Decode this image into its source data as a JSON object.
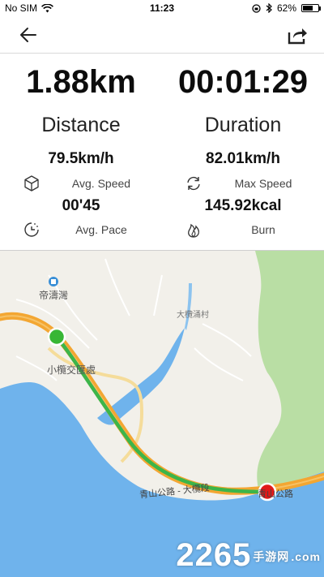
{
  "status_bar": {
    "carrier": "No SIM",
    "time": "11:23",
    "battery_percent": "62%",
    "battery_level": 0.62,
    "icons": [
      "wifi-icon",
      "rotation-lock-icon",
      "bluetooth-icon",
      "battery-icon"
    ]
  },
  "nav": {
    "back_icon": "arrow-left-icon",
    "share_icon": "share-export-icon"
  },
  "stats": {
    "distance": {
      "value": "1.88km",
      "label": "Distance"
    },
    "duration": {
      "value": "00:01:29",
      "label": "Duration"
    },
    "avg_speed": {
      "value": "79.5km/h",
      "label": "Avg. Speed",
      "icon": "cube-icon"
    },
    "max_speed": {
      "value": "82.01km/h",
      "label": "Max Speed",
      "icon": "refresh-cycle-icon"
    },
    "avg_pace": {
      "value": "00'45",
      "label": "Avg. Pace",
      "icon": "clock-icon"
    },
    "burn": {
      "value": "145.92kcal",
      "label": "Burn",
      "icon": "flame-icon"
    }
  },
  "map": {
    "labels": {
      "poi_1": "帝濤灣",
      "village": "大欖涌村",
      "interchange": "小欖交匯處",
      "road": "青山公路 - 大欖段",
      "road_end": "青山公路"
    },
    "colors": {
      "sea": "#6fb3ec",
      "land": "#f2f0ea",
      "green_area": "#b9dea4",
      "route": "#3cb54a",
      "road_orange": "#f3a632",
      "start_marker": "#37b635",
      "end_marker": "#e11919"
    }
  },
  "watermark": {
    "number": "2265",
    "site": "手游网",
    "domain": ".com"
  }
}
